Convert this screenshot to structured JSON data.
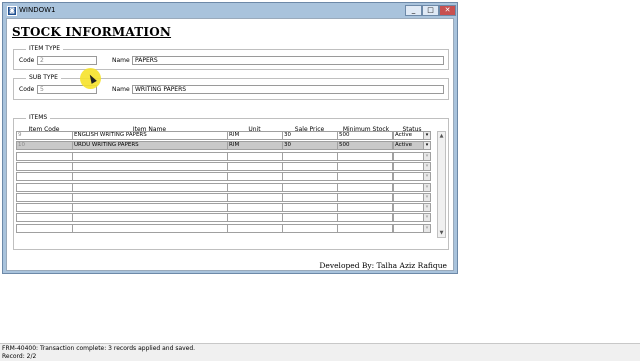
{
  "window": {
    "title": "WINDOW1",
    "min": "_",
    "max": "□",
    "close": "✕"
  },
  "form": {
    "heading": "STOCK INFORMATION",
    "item_type": {
      "legend": "ITEM TYPE",
      "code_label": "Code",
      "code_value": "2",
      "name_label": "Name",
      "name_value": "PAPERS"
    },
    "sub_type": {
      "legend": "SUB TYPE",
      "code_label": "Code",
      "code_value": "5",
      "name_label": "Name",
      "name_value": "WRITING PAPERS"
    },
    "items": {
      "legend": "ITEMS",
      "columns": [
        "Item Code",
        "Item Name",
        "Unit",
        "Sale Price",
        "Minimum  Stock",
        "Status"
      ],
      "rows": [
        {
          "code": "9",
          "name": "ENGLISH WRITING PAPERS",
          "unit": "RIM",
          "price": "30",
          "min_stock": "500",
          "status": "Active"
        },
        {
          "code": "10",
          "name": "URDU WRITING PAPERS",
          "unit": "RIM",
          "price": "30",
          "min_stock": "500",
          "status": "Active"
        }
      ]
    },
    "credit": "Developed By: Talha Aziz Rafique"
  },
  "statusbar": {
    "message": "FRM-40400: Transaction complete: 3 records applied and saved.",
    "record": "Record: 2/2"
  },
  "icons": {
    "window": "app-icon",
    "dropdown": "chevron-down-icon"
  }
}
